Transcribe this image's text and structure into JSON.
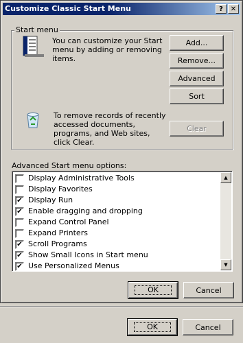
{
  "window": {
    "title": "Customize Classic Start Menu",
    "help_label": "?",
    "close_label": "✕"
  },
  "start_menu_group": {
    "label": "Start menu",
    "description": "You can customize your Start menu by adding or removing items.",
    "clear_description": "To remove records of recently accessed documents, programs, and Web sites, click Clear.",
    "buttons": {
      "add": "Add...",
      "remove": "Remove...",
      "advanced": "Advanced",
      "sort": "Sort",
      "clear": "Clear"
    }
  },
  "options": {
    "label": "Advanced Start menu options:",
    "items": [
      {
        "label": "Display Administrative Tools",
        "checked": false
      },
      {
        "label": "Display Favorites",
        "checked": false
      },
      {
        "label": "Display Run",
        "checked": true
      },
      {
        "label": "Enable dragging and dropping",
        "checked": true
      },
      {
        "label": "Expand Control Panel",
        "checked": false
      },
      {
        "label": "Expand Printers",
        "checked": false
      },
      {
        "label": "Scroll Programs",
        "checked": true
      },
      {
        "label": "Show Small Icons in Start menu",
        "checked": true
      },
      {
        "label": "Use Personalized Menus",
        "checked": true
      }
    ],
    "scroll_up": "▲",
    "scroll_down": "▼"
  },
  "dialog_buttons": {
    "ok": "OK",
    "cancel": "Cancel"
  },
  "parent_buttons": {
    "ok": "OK",
    "cancel": "Cancel"
  },
  "colors": {
    "titlebar": "#0a246a",
    "face": "#d4d0c8"
  }
}
